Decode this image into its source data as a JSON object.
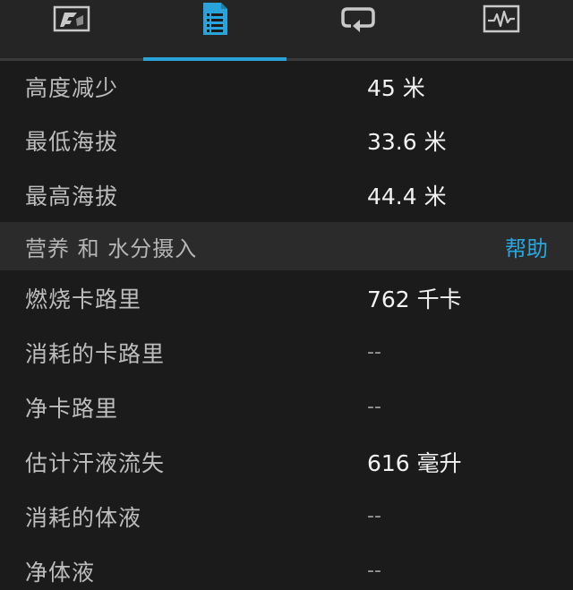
{
  "tabs": [
    {
      "id": "map",
      "icon": "map-icon",
      "active": false
    },
    {
      "id": "details",
      "icon": "list-document-icon",
      "active": true
    },
    {
      "id": "laps",
      "icon": "loop-icon",
      "active": false
    },
    {
      "id": "charts",
      "icon": "activity-chart-icon",
      "active": false
    }
  ],
  "colors": {
    "accent": "#29a3da",
    "background": "#1b1b1b",
    "section_background": "#2b2b2b",
    "label": "#bdbdbd",
    "value": "#f2f2f2"
  },
  "elevation_rows": [
    {
      "label": "高度减少",
      "value": "45 米"
    },
    {
      "label": "最低海拔",
      "value": "33.6 米"
    },
    {
      "label": "最高海拔",
      "value": "44.4 米"
    }
  ],
  "nutrition_section": {
    "title": "营养 和 水分摄入",
    "help_label": "帮助"
  },
  "nutrition_rows": [
    {
      "label": "燃烧卡路里",
      "value": "762 千卡"
    },
    {
      "label": "消耗的卡路里",
      "value": "--"
    },
    {
      "label": "净卡路里",
      "value": "--"
    },
    {
      "label": "估计汗液流失",
      "value": "616 毫升"
    },
    {
      "label": "消耗的体液",
      "value": "--"
    },
    {
      "label": "净体液",
      "value": "--"
    }
  ]
}
